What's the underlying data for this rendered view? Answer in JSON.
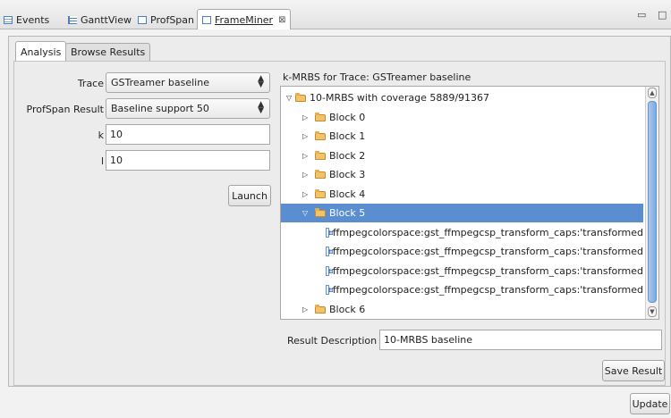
{
  "view_tabs": [
    {
      "label": "Events",
      "icon": "table-icon"
    },
    {
      "label": "GanttView",
      "icon": "gantt-icon"
    },
    {
      "label": "ProfSpan",
      "icon": "view-icon"
    },
    {
      "label": "FrameMiner",
      "icon": "view-icon",
      "active": true,
      "close": "⊠"
    }
  ],
  "window_controls": {
    "minimize": "▭",
    "maximize": "□"
  },
  "inner_tabs": [
    {
      "label": "Analysis",
      "active": true
    },
    {
      "label": "Browse Results",
      "active": false
    }
  ],
  "form": {
    "trace_label": "Trace",
    "trace_value": "GSTreamer baseline",
    "profspan_label": "ProfSpan Result",
    "profspan_value": "Baseline support 50",
    "k_label": "k",
    "k_value": "10",
    "l_label": "l",
    "l_value": "10",
    "launch_label": "Launch"
  },
  "results": {
    "heading": "k-MRBS for Trace: GSTreamer baseline",
    "root_label": "10-MRBS with coverage 5889/91367",
    "blocks": [
      "Block 0",
      "Block 1",
      "Block 2",
      "Block 3",
      "Block 4",
      "Block 5",
      "Block 6"
    ],
    "selected_block": "Block 5",
    "block5_children": [
      "ffmpegcolorspace:gst_ffmpegcsp_transform_caps:'transformed",
      "ffmpegcolorspace:gst_ffmpegcsp_transform_caps:'transformed",
      "ffmpegcolorspace:gst_ffmpegcsp_transform_caps:'transformed",
      "ffmpegcolorspace:gst_ffmpegcsp_transform_caps:'transformed"
    ],
    "description_label": "Result Description",
    "description_value": "10-MRBS baseline",
    "save_label": "Save Result"
  },
  "update_label": "Update",
  "colors": {
    "selection": "#5a8ed0",
    "folder": "#f3c36b"
  }
}
